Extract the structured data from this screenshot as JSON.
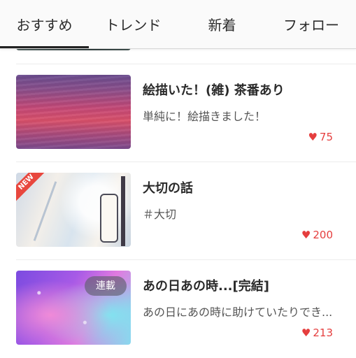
{
  "tabs": [
    {
      "label": "おすすめ",
      "active": true
    },
    {
      "label": "トレンド",
      "active": false
    },
    {
      "label": "新着",
      "active": false
    },
    {
      "label": "フォロー",
      "active": false
    }
  ],
  "items": [
    {
      "title": "絵描いた！(雑) 茶番あり",
      "description": "単純に！絵描きました！",
      "likes": "75",
      "badge": ""
    },
    {
      "title": "大切の話",
      "description": "＃大切",
      "likes": "200",
      "badge": "NEW"
    },
    {
      "title": "あの日あの時...[完結]",
      "description": "あの日にあの時に助けていたりでき...",
      "likes": "213",
      "badge": "連載"
    }
  ],
  "icons": {
    "heart": "heart-icon"
  },
  "colors": {
    "accent": "#e53e3e",
    "new_badge": "#e8473e",
    "tab_indicator": "#222222"
  }
}
